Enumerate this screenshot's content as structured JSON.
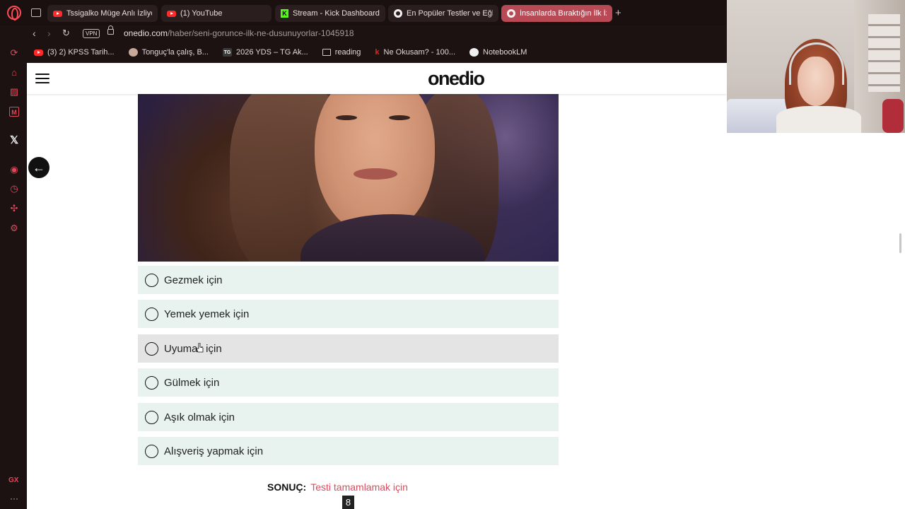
{
  "tabs": [
    {
      "label": "Tssigalko Müge Anlı İzliyor",
      "icon": "youtube-icon",
      "active": false
    },
    {
      "label": "(1) YouTube",
      "icon": "youtube-icon",
      "active": false
    },
    {
      "label": "Stream - Kick Dashboard",
      "icon": "kick-icon",
      "active": false
    },
    {
      "label": "En Popüler Testler ve Eğle",
      "icon": "onedio-icon",
      "active": false
    },
    {
      "label": "İnsanlarda Bıraktığın İlk İzle",
      "icon": "onedio-icon",
      "active": true
    }
  ],
  "address": {
    "vpn": "VPN",
    "domain": "onedio.com",
    "path": "/haber/seni-gorunce-ilk-ne-dusunuyorlar-1045918"
  },
  "bookmarks": [
    {
      "label": "(3) 2) KPSS Tarih...",
      "icon": "youtube-icon"
    },
    {
      "label": "Tonguç'la çalış, B...",
      "icon": "avatar-icon"
    },
    {
      "label": "2026 YDS – TG Ak...",
      "icon": "tg-icon"
    },
    {
      "label": "reading",
      "icon": "folder-icon"
    },
    {
      "label": "Ne Okusam? - 100...",
      "icon": "k-icon"
    },
    {
      "label": "NotebookLM",
      "icon": "notebooklm-icon"
    }
  ],
  "sidebar": {
    "gx": "GX",
    "more": "···"
  },
  "site": {
    "logo": "onedio"
  },
  "quiz": {
    "options": [
      {
        "label": "Gezmek için"
      },
      {
        "label": "Yemek yemek için"
      },
      {
        "label": "Uyumak için"
      },
      {
        "label": "Gülmek için"
      },
      {
        "label": "Aşık olmak için"
      },
      {
        "label": "Alışveriş yapmak için"
      }
    ],
    "result_key": "SONUÇ:",
    "result_value": "Testi tamamlamak için",
    "badge": "8"
  },
  "colors": {
    "accent": "#e2485a",
    "option_bg": "#e8f3ef",
    "option_hover_bg": "#e4e4e4",
    "active_tab": "#b74a55"
  }
}
